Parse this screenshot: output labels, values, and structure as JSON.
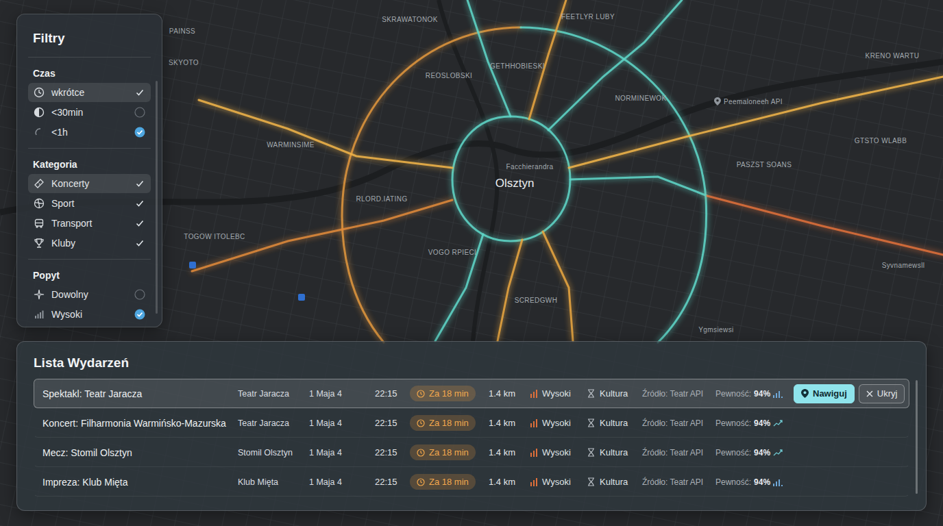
{
  "map": {
    "city": "Olsztyn",
    "labels": [
      "PAINSS",
      "SKYOTO",
      "SKRAWATONOK",
      "FEETLYR LUBY",
      "KRENO WARTU",
      "REOSLOBSKI",
      "GETHHOBIESKI",
      "NORMINEWOK",
      "Peemaloneeh API",
      "GTSTO WLABB",
      "WARMINSIME",
      "Facchierandra",
      "PASZST SOANS",
      "RLORD.IATING",
      "TOGOW ITOLEBC",
      "VOGO RPIECI",
      "Syvnamewsll",
      "SCREDGWH",
      "Ygmsiewsi"
    ],
    "roads": [
      {
        "color": "#5fd6c8"
      },
      {
        "color": "#e0963e"
      },
      {
        "color": "#5fd6c8"
      },
      {
        "color": "#5fd6c8"
      },
      {
        "color": "#e8a640"
      },
      {
        "color": "#5fd6c8"
      },
      {
        "color": "#f0b44a"
      },
      {
        "color": "#5fd6c8"
      },
      {
        "color": "#e0703a"
      },
      {
        "color": "#f0b44a"
      },
      {
        "color": "#e08a3a"
      },
      {
        "color": "#5fd6c8"
      },
      {
        "color": "#e8a640"
      },
      {
        "color": "#e8a640"
      }
    ]
  },
  "filters": {
    "title": "Filtry",
    "sections": [
      {
        "title": "Czas",
        "items": [
          {
            "label": "wkrótce",
            "kind": "tick",
            "checked": true,
            "selected": true
          },
          {
            "label": "<30min",
            "kind": "radio",
            "checked": false,
            "selected": false
          },
          {
            "label": "<1h",
            "kind": "radio",
            "checked": true,
            "selected": false
          }
        ]
      },
      {
        "title": "Kategoria",
        "items": [
          {
            "label": "Koncerty",
            "kind": "tick",
            "checked": true,
            "selected": true
          },
          {
            "label": "Sport",
            "kind": "tick",
            "checked": true,
            "selected": false
          },
          {
            "label": "Transport",
            "kind": "tick",
            "checked": true,
            "selected": false
          },
          {
            "label": "Kluby",
            "kind": "tick",
            "checked": true,
            "selected": false
          }
        ]
      },
      {
        "title": "Popyt",
        "items": [
          {
            "label": "Dowolny",
            "kind": "radio",
            "checked": false,
            "selected": false
          },
          {
            "label": "Wysoki",
            "kind": "radio",
            "checked": true,
            "selected": false
          }
        ]
      }
    ]
  },
  "events": {
    "title": "Lista Wydarzeń",
    "actions": [
      {
        "label": "Nawiguj",
        "kind": "primary"
      },
      {
        "label": "Ukryj",
        "kind": "secondary"
      }
    ],
    "rows": [
      {
        "name": "Spektakl: Teatr Jaracza",
        "venue": "Teatr Jaracza",
        "address": "1 Maja 4",
        "time": "22:15",
        "eta": "Za 18 min",
        "distance": "1.4 km",
        "demand": "Wysoki",
        "category": "Kultura",
        "source": "Źródło: Teatr API",
        "confidence_label": "Pewność:",
        "confidence": "94%",
        "trend": "bars",
        "selected": true
      },
      {
        "name": "Koncert: Filharmonia Warmińsko-Mazurska",
        "venue": "Teatr Jaracza",
        "address": "1 Maja 4",
        "time": "22:15",
        "eta": "Za 18 min",
        "distance": "1.4 km",
        "demand": "Wysoki",
        "category": "Kultura",
        "source": "Źródło: Teatr API",
        "confidence_label": "Pewność:",
        "confidence": "94%",
        "trend": "line",
        "selected": false
      },
      {
        "name": "Mecz: Stomil Olsztyn",
        "venue": "Stomil Olsztyn",
        "address": "1 Maja 4",
        "time": "22:15",
        "eta": "Za 18 min",
        "distance": "1.4 km",
        "demand": "Wysoki",
        "category": "Kultura",
        "source": "Źródło: Teatr API",
        "confidence_label": "Pewność:",
        "confidence": "94%",
        "trend": "line",
        "selected": false
      },
      {
        "name": "Impreza: Klub Mięta",
        "venue": "Klub Mięta",
        "address": "1 Maja 4",
        "time": "22:15",
        "eta": "Za 18 min",
        "distance": "1.4 km",
        "demand": "Wysoki",
        "category": "Kultura",
        "source": "Źródło: Teatr API",
        "confidence_label": "Pewność:",
        "confidence": "94%",
        "trend": "bars",
        "selected": false
      }
    ]
  }
}
